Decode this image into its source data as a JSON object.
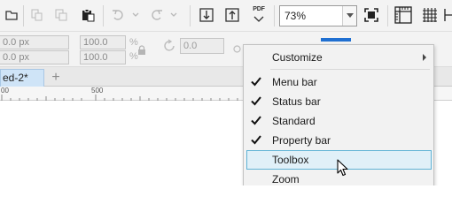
{
  "standard_toolbar": {
    "pdf_label": "PDF",
    "zoom": {
      "value": "73%"
    }
  },
  "property_bar": {
    "x_field": "0.0 px",
    "y_field": "0.0 px",
    "scale_x": "100.0",
    "scale_y": "100.0",
    "percent_symbol": "%",
    "rotation": "0.0"
  },
  "document_tabs": {
    "active_tab_label": "ed-2*",
    "add_tab_symbol": "+"
  },
  "ruler": {
    "labels": [
      "00",
      "500"
    ]
  },
  "context_menu": {
    "items": [
      {
        "label": "Customize",
        "checked": false,
        "submenu": true
      },
      {
        "label": "Menu bar",
        "checked": true
      },
      {
        "label": "Status bar",
        "checked": true
      },
      {
        "label": "Standard",
        "checked": true
      },
      {
        "label": "Property bar",
        "checked": true
      },
      {
        "label": "Toolbox",
        "checked": false,
        "highlighted": true
      },
      {
        "label": "Zoom",
        "checked": false
      }
    ]
  },
  "colors": {
    "menu_highlight_fill": "#e0f0f8",
    "menu_highlight_border": "#5fb3d5",
    "active_tab": "#cfe4f7"
  }
}
